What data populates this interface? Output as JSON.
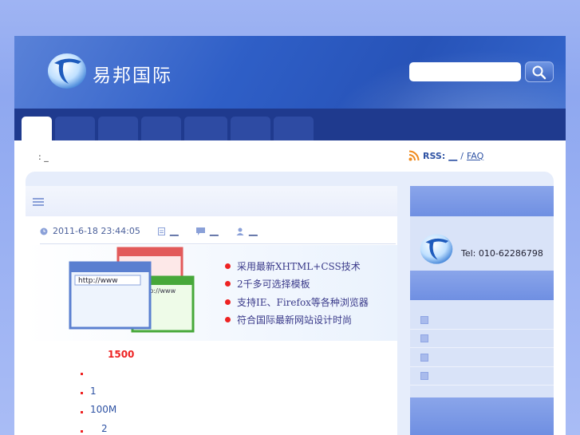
{
  "header": {
    "logo_text": "易邦国际",
    "search": {
      "value": "",
      "placeholder": ""
    }
  },
  "nav": {
    "tabs": [
      {
        "label": "",
        "active": true
      },
      {
        "label": "",
        "active": false
      },
      {
        "label": "",
        "active": false
      },
      {
        "label": "",
        "active": false
      },
      {
        "label": "",
        "active": false
      },
      {
        "label": "",
        "active": false
      },
      {
        "label": "",
        "active": false
      }
    ]
  },
  "breadcrumb": ": _",
  "rss": {
    "label": "RSS:",
    "link1": "__",
    "sep": "/",
    "link2": "FAQ"
  },
  "post": {
    "date": "2011-6-18 23:44:05",
    "category": "__",
    "comments": "__",
    "author": "__",
    "features": [
      "采用最新XHTML+CSS技术",
      "2千多可选择模板",
      "支持IE、Firefox等各种浏览器",
      "符合国际最新网站设计时尚"
    ],
    "banner_url_text": "http://www",
    "price": "1500",
    "specs": [
      "",
      "1",
      "100M",
      "2"
    ]
  },
  "sidebar": {
    "tel": "Tel: 010-62286798"
  },
  "colors": {
    "accent": "#2f5fc7",
    "nav_bg": "#1f3a8e",
    "highlight": "#e22222"
  }
}
